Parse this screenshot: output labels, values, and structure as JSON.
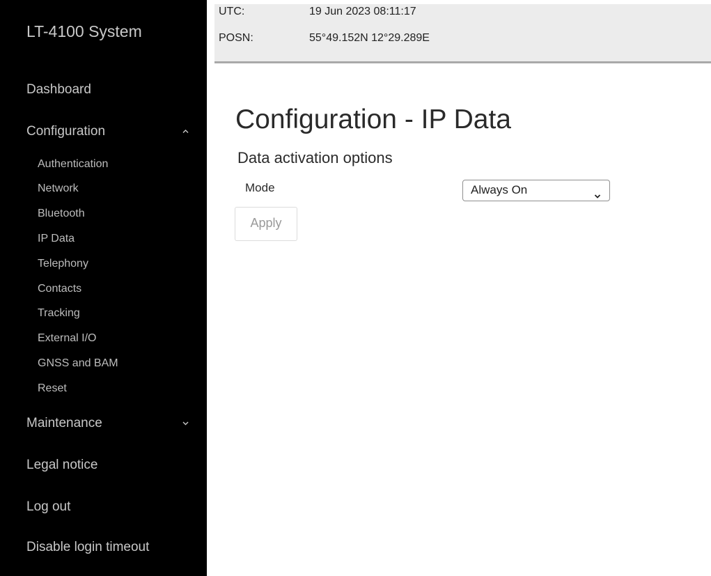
{
  "sidebar": {
    "brand": "LT-4100 System",
    "dashboard": "Dashboard",
    "configuration": {
      "label": "Configuration",
      "icon": "chevron-up-icon",
      "items": [
        {
          "label": "Authentication"
        },
        {
          "label": "Network"
        },
        {
          "label": "Bluetooth"
        },
        {
          "label": "IP Data"
        },
        {
          "label": "Telephony"
        },
        {
          "label": "Contacts"
        },
        {
          "label": "Tracking"
        },
        {
          "label": "External I/O"
        },
        {
          "label": "GNSS and BAM"
        },
        {
          "label": "Reset"
        }
      ]
    },
    "maintenance": {
      "label": "Maintenance",
      "icon": "chevron-down-icon"
    },
    "legal_notice": "Legal notice",
    "log_out": "Log out",
    "disable_login_timeout": "Disable login timeout"
  },
  "status": {
    "utc_label": "UTC:",
    "utc_value": "19 Jun 2023 08:11:17",
    "posn_label": "POSN:",
    "posn_value": "55°49.152N 12°29.289E"
  },
  "main": {
    "title": "Configuration - IP Data",
    "section_title": "Data activation options",
    "mode_label": "Mode",
    "mode_value": "Always On",
    "apply_label": "Apply"
  },
  "colors": {
    "sidebar_bg": "#000000",
    "sidebar_text": "#c8c8c8",
    "topbar_bg": "#ececec",
    "topbar_border": "#a9a9a9"
  }
}
